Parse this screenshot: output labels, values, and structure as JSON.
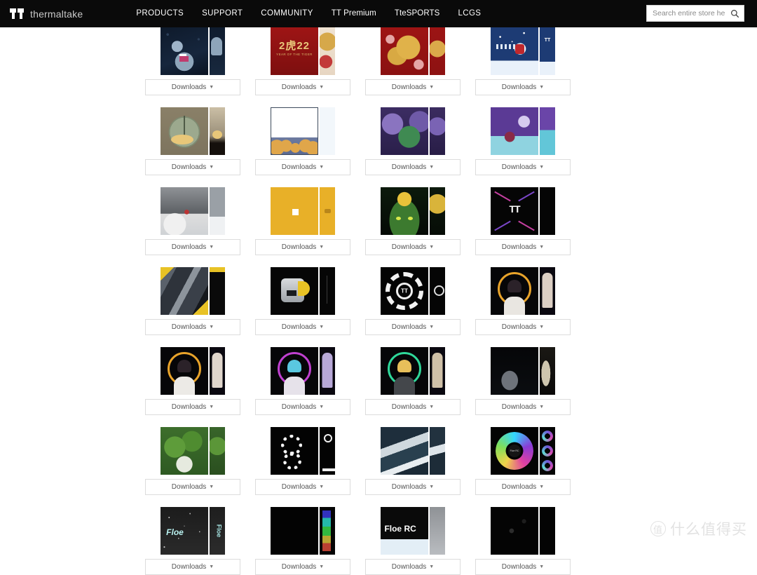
{
  "header": {
    "brand_name": "thermaltake",
    "brand_mark_icon": "tt-logo-icon",
    "nav": [
      {
        "label": "PRODUCTS"
      },
      {
        "label": "SUPPORT"
      },
      {
        "label": "COMMUNITY"
      },
      {
        "label": "TT Premium"
      },
      {
        "label": "TteSPORTS"
      },
      {
        "label": "LCGS"
      }
    ],
    "search": {
      "placeholder": "Search entire store he",
      "value": "",
      "icon": "search-icon"
    }
  },
  "grid": {
    "button_label": "Downloads",
    "button_caret": "▼",
    "rows": [
      {
        "cards": [
          {
            "art": "robot",
            "art_side": "robot-s",
            "caption": "Downloads"
          },
          {
            "art": "2022",
            "art_side": "2022-s",
            "caption": "Downloads"
          },
          {
            "art": "tiger",
            "art_side": "tiger-s",
            "caption": "Downloads"
          },
          {
            "art": "xmas",
            "art_side": "xmas-s",
            "caption": "Downloads"
          }
        ]
      },
      {
        "cards": [
          {
            "art": "hamster",
            "art_side": "hamster-s",
            "caption": "Downloads"
          },
          {
            "art": "page",
            "art_side": "page-s",
            "caption": "Downloads"
          },
          {
            "art": "coral",
            "art_side": "coral-s",
            "caption": "Downloads"
          },
          {
            "art": "night",
            "art_side": "night-s",
            "caption": "Downloads"
          }
        ]
      },
      {
        "cards": [
          {
            "art": "bw",
            "art_side": "bw-s",
            "caption": "Downloads"
          },
          {
            "art": "yellow",
            "art_side": "yellow-s",
            "caption": "Downloads"
          },
          {
            "art": "frog",
            "art_side": "frog-s",
            "caption": "Downloads"
          },
          {
            "art": "ttneon",
            "art_side": "ttneon-s",
            "caption": "Downloads"
          }
        ]
      },
      {
        "cards": [
          {
            "art": "mech",
            "art_side": "mech-s",
            "caption": "Downloads"
          },
          {
            "art": "car",
            "art_side": "car-s",
            "caption": "Downloads"
          },
          {
            "art": "zodiac",
            "art_side": "zodiac-s",
            "caption": "Downloads"
          },
          {
            "art": "anime1",
            "art_side": "anime1-s",
            "caption": "Downloads"
          }
        ]
      },
      {
        "cards": [
          {
            "art": "anime2",
            "art_side": "anime2-s",
            "caption": "Downloads"
          },
          {
            "art": "anime3",
            "art_side": "anime3-s",
            "caption": "Downloads"
          },
          {
            "art": "anime4",
            "art_side": "anime4-s",
            "caption": "Downloads"
          },
          {
            "art": "darkcar",
            "art_side": "darkcar-s",
            "caption": "Downloads"
          }
        ]
      },
      {
        "cards": [
          {
            "art": "garden",
            "art_side": "garden-s",
            "caption": "Downloads"
          },
          {
            "art": "gears",
            "art_side": "gears-s",
            "caption": "Downloads"
          },
          {
            "art": "ocean",
            "art_side": "ocean-s",
            "caption": "Downloads"
          },
          {
            "art": "rgb",
            "art_side": "rgb-s",
            "caption": "Downloads"
          }
        ]
      },
      {
        "cards": [
          {
            "art": "floe",
            "art_side": "floe-s",
            "caption": "Downloads"
          },
          {
            "art": "black",
            "art_side": "black-s",
            "caption": "Downloads"
          },
          {
            "art": "floerc",
            "art_side": "floerc-s",
            "caption": "Downloads"
          },
          {
            "art": "sparse",
            "art_side": "sparse-s",
            "caption": "Downloads"
          }
        ]
      }
    ]
  },
  "art_labels": {
    "year_big": "2虎22",
    "year_sub": "YEAR OF THE TIGER",
    "tt_mark": "TT",
    "floe": "Floe",
    "floe_rc": "Floe RC",
    "rgb_hub": "Floe RC"
  },
  "watermark": {
    "badge": "值",
    "text": "什么值得买"
  }
}
